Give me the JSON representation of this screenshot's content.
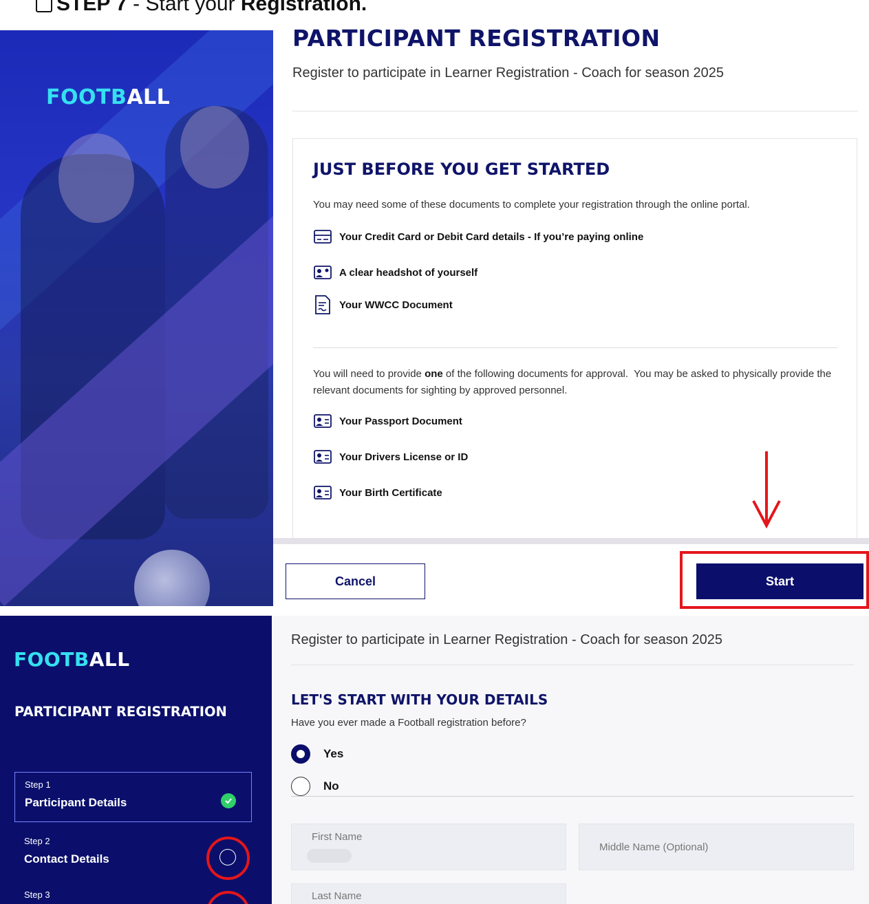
{
  "step_header": {
    "prefix": "STEP 7",
    "middle": " - Start your ",
    "bold": "Registration."
  },
  "brand": {
    "part1": "FOOTB",
    "part2": "ALL"
  },
  "panel1": {
    "title": "PARTICIPANT REGISTRATION",
    "subtitle": "Register to participate in Learner Registration - Coach for season 2025",
    "card": {
      "title": "JUST BEFORE YOU GET STARTED",
      "intro": "You may need some of these documents to complete your registration through the online portal.",
      "docs": [
        {
          "icon": "credit-card-icon",
          "label": "Your Credit Card or Debit Card details - If you’re paying online"
        },
        {
          "icon": "headshot-icon",
          "label": "A clear headshot of yourself"
        },
        {
          "icon": "document-icon",
          "label": "Your WWCC Document"
        }
      ],
      "para_before": "You will need to provide ",
      "para_bold": "one",
      "para_after": " of the following documents for approval.  You may be asked to physically provide the relevant documents for sighting by approved personnel.",
      "id_docs": [
        {
          "icon": "id-card-icon",
          "label": "Your Passport Document"
        },
        {
          "icon": "id-card-icon",
          "label": "Your Drivers License or ID"
        },
        {
          "icon": "id-card-icon",
          "label": "Your Birth Certificate"
        }
      ]
    },
    "cancel_label": "Cancel",
    "start_label": "Start",
    "highlight_color": "#e4161b"
  },
  "panel2": {
    "sidebar_title": "PARTICIPANT REGISTRATION",
    "steps": [
      {
        "label": "Step 1",
        "name": "Participant Details",
        "status": "complete"
      },
      {
        "label": "Step 2",
        "name": "Contact Details",
        "status": "pending"
      },
      {
        "label": "Step 3",
        "name": "",
        "status": "pending"
      }
    ],
    "subtitle": "Register to participate in Learner Registration - Coach for season 2025",
    "section_title": "LET'S START WITH YOUR DETAILS",
    "question": "Have you ever made a Football registration before?",
    "options": [
      {
        "label": "Yes",
        "selected": true
      },
      {
        "label": "No",
        "selected": false
      }
    ],
    "fields": {
      "first_name": "First Name",
      "middle_name": "Middle Name (Optional)",
      "last_name": "Last Name"
    }
  },
  "colors": {
    "navy": "#0b0f6b",
    "brand_cyan": "#35e0f0",
    "check_green": "#2fcf6a",
    "annotation_red": "#e4161b"
  }
}
